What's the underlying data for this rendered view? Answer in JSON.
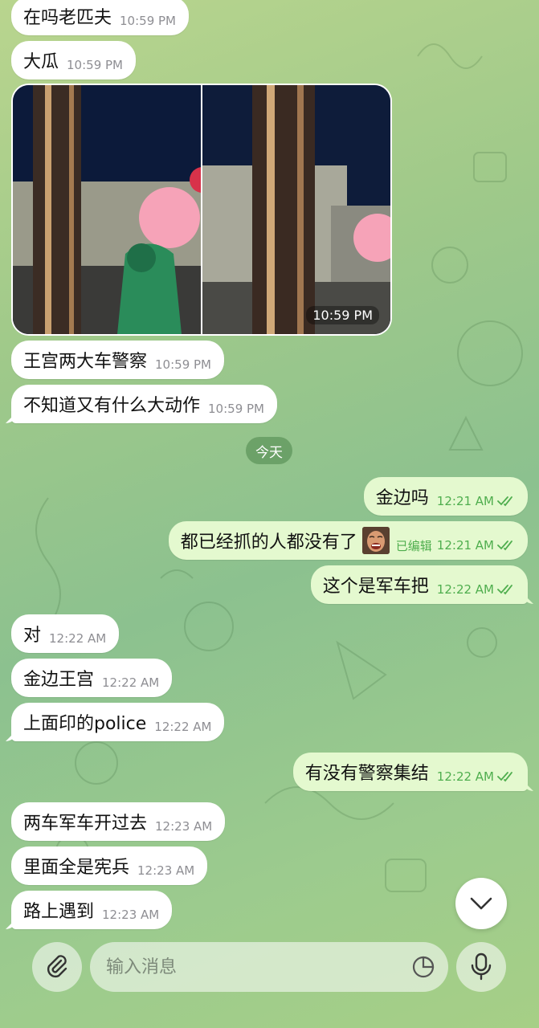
{
  "messages": {
    "m1": {
      "text": "在吗老匹夫",
      "time": "10:59 PM"
    },
    "m2": {
      "text": "大瓜",
      "time": "10:59 PM"
    },
    "photo": {
      "time": "10:59 PM"
    },
    "m3": {
      "text": "王宫两大车警察",
      "time": "10:59 PM"
    },
    "m4": {
      "text": "不知道又有什么大动作",
      "time": "10:59 PM"
    },
    "date_divider": "今天",
    "o1": {
      "text": "金边吗",
      "time": "12:21 AM"
    },
    "o2": {
      "text": "都已经抓的人都没有了",
      "edited": "已编辑",
      "time": "12:21 AM"
    },
    "o3": {
      "text": "这个是军车把",
      "time": "12:22 AM"
    },
    "m5": {
      "text": "对",
      "time": "12:22 AM"
    },
    "m6": {
      "text": "金边王宫",
      "time": "12:22 AM"
    },
    "m7": {
      "text": "上面印的police",
      "time": "12:22 AM"
    },
    "o4": {
      "text": "有没有警察集结",
      "time": "12:22 AM"
    },
    "m8": {
      "text": "两车军车开过去",
      "time": "12:23 AM"
    },
    "m9": {
      "text": "里面全是宪兵",
      "time": "12:23 AM"
    },
    "m10": {
      "text": "路上遇到",
      "time": "12:23 AM"
    }
  },
  "composer": {
    "placeholder": "输入消息",
    "attach_icon": "paperclip-icon",
    "sticker_icon": "sticker-icon",
    "mic_icon": "microphone-icon"
  },
  "scroll_down_icon": "chevron-down-icon",
  "colors": {
    "incoming_bubble": "#ffffff",
    "outgoing_bubble": "#e4f9cf",
    "outgoing_meta": "#4fae4e"
  }
}
